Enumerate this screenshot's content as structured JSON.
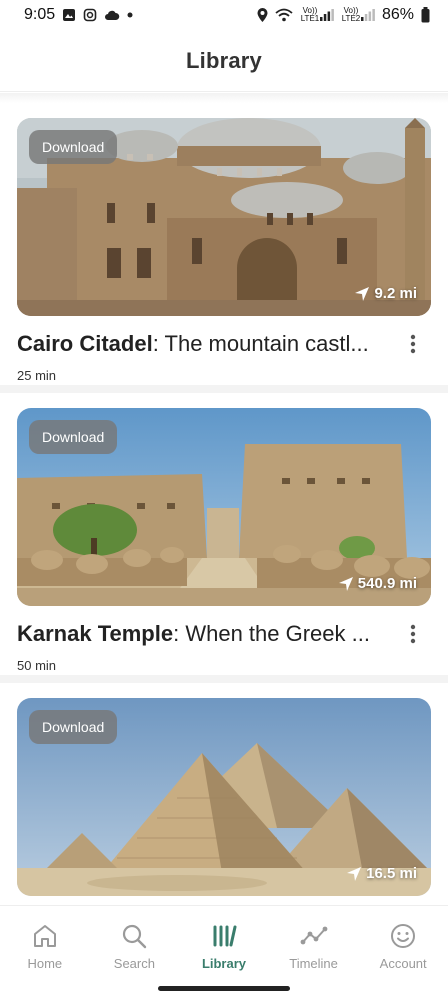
{
  "status_bar": {
    "time": "9:05",
    "network_1": "Vo)) LTE1",
    "network_2": "Vo)) LTE2",
    "battery": "86%"
  },
  "header": {
    "title": "Library"
  },
  "tours": [
    {
      "name": "Cairo Citadel",
      "subtitle": ": The mountain castl...",
      "duration": "25 min",
      "distance": "9.2 mi",
      "download_label": "Download",
      "image": "citadel-mosque"
    },
    {
      "name": "Karnak Temple",
      "subtitle": ": When the Greek ...",
      "duration": "50 min",
      "distance": "540.9 mi",
      "download_label": "Download",
      "image": "karnak-pylons"
    },
    {
      "name": "",
      "subtitle": "",
      "duration": "",
      "distance": "16.5 mi",
      "download_label": "Download",
      "image": "giza-pyramids"
    }
  ],
  "bottom_nav": [
    {
      "label": "Home",
      "icon": "home-icon",
      "active": false
    },
    {
      "label": "Search",
      "icon": "search-icon",
      "active": false
    },
    {
      "label": "Library",
      "icon": "library-icon",
      "active": true
    },
    {
      "label": "Timeline",
      "icon": "timeline-icon",
      "active": false
    },
    {
      "label": "Account",
      "icon": "account-icon",
      "active": false
    }
  ],
  "colors": {
    "accent": "#3a7d6c",
    "inactive": "#9a9a9a"
  }
}
